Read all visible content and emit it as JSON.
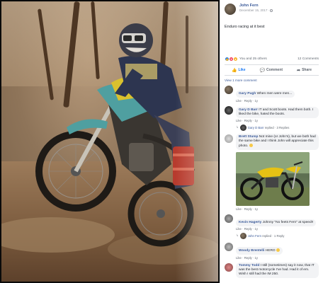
{
  "post": {
    "author": "John Fern",
    "date": "December 15, 2017 ·",
    "caption": "Enduro racing at it best",
    "reactions_summary": "You and 25 others",
    "comments_count": "12 Comments"
  },
  "actions": {
    "like": "Like",
    "comment": "Comment",
    "share": "Share"
  },
  "more_replies": "View 1 more comment",
  "comments": [
    {
      "name": "Gary Pugh",
      "text": "When men were men...",
      "links": "Like · Reply · 1y"
    },
    {
      "name": "Gary D Barr",
      "text": "IT and Scott boots. Had them both. I liked the bike, hated the boots.",
      "links": "Like · Reply · 1y",
      "reply_name": "Gary D Barr",
      "reply_text": "replied · 3 Replies"
    },
    {
      "name": "Brett Stump",
      "text": "Not mine (or John's), but we both had the same bike and I think John will appreciate this photo.",
      "links": "Like · Reply · 1y"
    },
    {
      "name": "Kevin Hagerty",
      "text": "Johnny \"No feets Fern\" at speed!!",
      "links": "Like · Reply · 1y",
      "reply_name": "John Fern",
      "reply_text": "replied · 1 Reply"
    },
    {
      "name": "Woody Brentelli",
      "text": "HERO",
      "links": "Like · Reply · 1y"
    },
    {
      "name": "Tommy Todd",
      "text": "I still (sometimes) say it now, that IT was the best motorcycle I've had. Had it of em. Wish I still had the IM 250.",
      "links": ""
    }
  ],
  "colors": {
    "link_blue": "#385898",
    "like_blue": "#1877f2",
    "bike_yellow": "#d9c12e",
    "bike_teal": "#4f9fa0"
  }
}
